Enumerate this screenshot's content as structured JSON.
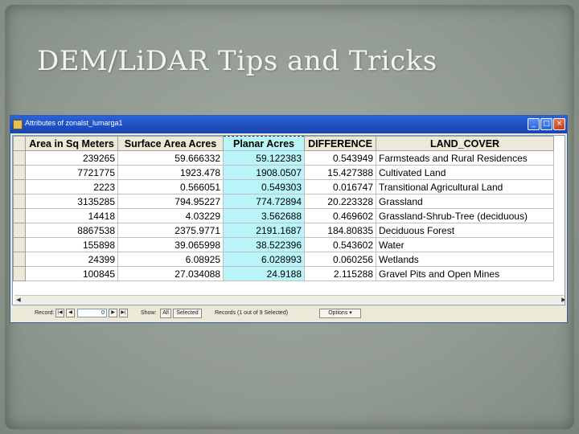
{
  "slide": {
    "title": "DEM/LiDAR Tips and Tricks"
  },
  "window": {
    "title": "Attributes of zonalst_lumarga1",
    "minimize_glyph": "_",
    "maximize_glyph": "□",
    "close_glyph": "×"
  },
  "table": {
    "columns": [
      "Area in Sq Meters",
      "Surface Area Acres",
      "Planar Acres",
      "DIFFERENCE",
      "LAND_COVER"
    ],
    "rows": [
      [
        "239265",
        "59.666332",
        "59.122383",
        "0.543949",
        "Farmsteads and Rural Residences"
      ],
      [
        "7721775",
        "1923.478",
        "1908.0507",
        "15.427388",
        "Cultivated Land"
      ],
      [
        "2223",
        "0.566051",
        "0.549303",
        "0.016747",
        "Transitional Agricultural Land"
      ],
      [
        "3135285",
        "794.95227",
        "774.72894",
        "20.223328",
        "Grassland"
      ],
      [
        "14418",
        "4.03229",
        "3.562688",
        "0.469602",
        "Grassland-Shrub-Tree (deciduous)"
      ],
      [
        "8867538",
        "2375.9771",
        "2191.1687",
        "184.80835",
        "Deciduous Forest"
      ],
      [
        "155898",
        "39.065998",
        "38.522396",
        "0.543602",
        "Water"
      ],
      [
        "24399",
        "6.08925",
        "6.028993",
        "0.060256",
        "Wetlands"
      ],
      [
        "100845",
        "27.034088",
        "24.9188",
        "2.115288",
        "Gravel Pits and Open Mines"
      ]
    ],
    "selected_column": "Planar Acres"
  },
  "statusbar": {
    "record_label": "Record:",
    "record_value": "0",
    "show_label": "Show:",
    "all_label": "All",
    "selected_label": "Selected",
    "records_text": "Records (1 out of 9 Selected)",
    "options_label": "Options"
  },
  "colors": {
    "selection": "#b8f4f8",
    "titlebar": "#2b63d9"
  }
}
